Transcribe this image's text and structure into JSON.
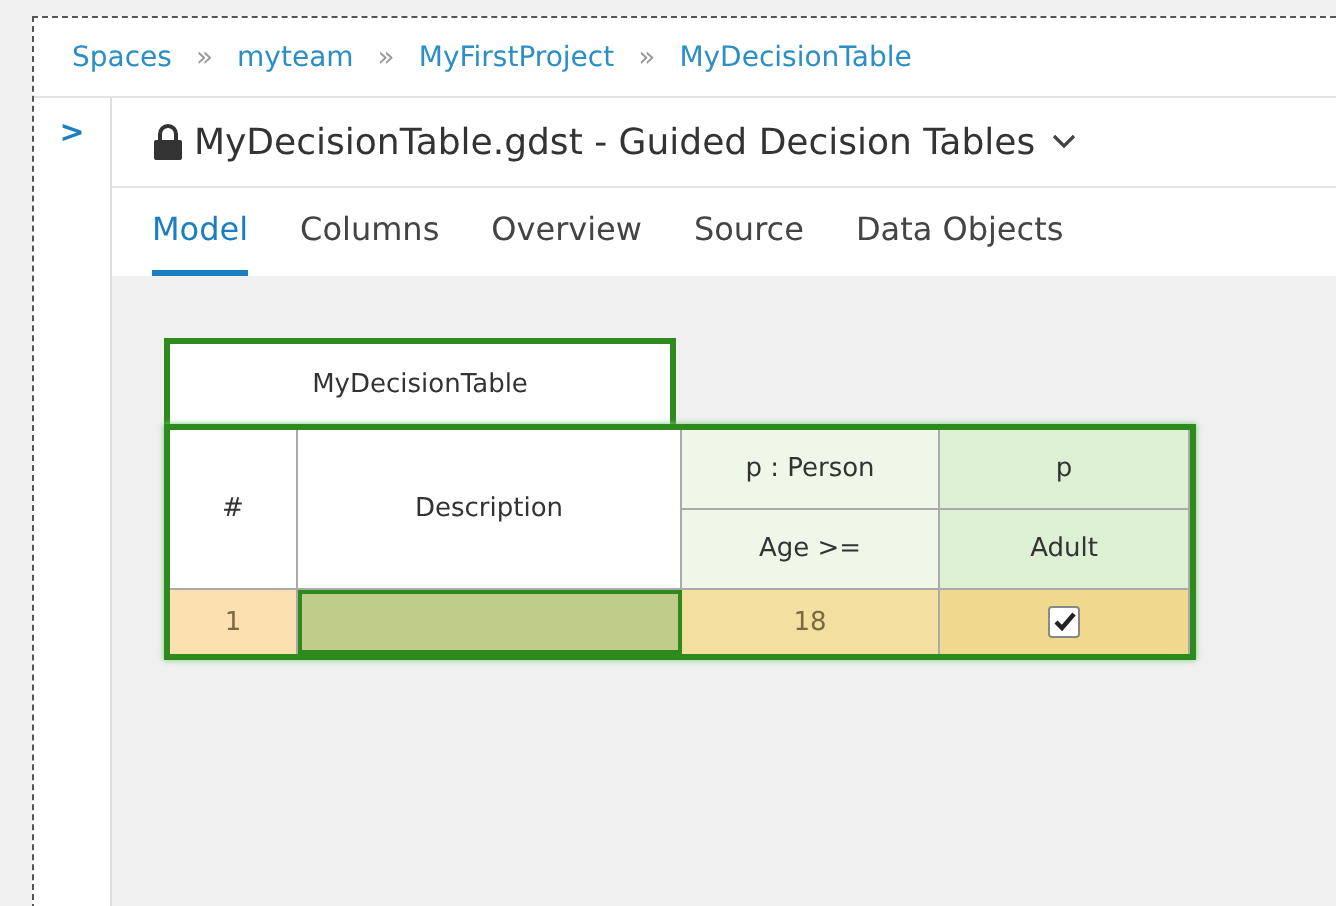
{
  "breadcrumbs": [
    "Spaces",
    "myteam",
    "MyFirstProject",
    "MyDecisionTable"
  ],
  "breadcrumb_separator": "»",
  "sidebar": {
    "toggle": ">"
  },
  "editor": {
    "title": "MyDecisionTable.gdst - Guided Decision Tables",
    "locked": true
  },
  "tabs": [
    {
      "label": "Model",
      "selected": true
    },
    {
      "label": "Columns",
      "selected": false
    },
    {
      "label": "Overview",
      "selected": false
    },
    {
      "label": "Source",
      "selected": false
    },
    {
      "label": "Data Objects",
      "selected": false
    }
  ],
  "decision_table": {
    "name": "MyDecisionTable",
    "columns": [
      {
        "kind": "plain",
        "label": "#"
      },
      {
        "kind": "plain",
        "label": "Description"
      },
      {
        "kind": "condition",
        "pattern": "p : Person",
        "label": "Age >="
      },
      {
        "kind": "action",
        "pattern": "p",
        "label": "Adult"
      }
    ],
    "rows": [
      {
        "cells": [
          {
            "kind": "number",
            "text": "1",
            "selected": false
          },
          {
            "kind": "text",
            "selected": true
          },
          {
            "kind": "text",
            "text": "18",
            "selected": false
          },
          {
            "kind": "checkbox",
            "checked": true,
            "selected": false
          }
        ]
      }
    ]
  }
}
